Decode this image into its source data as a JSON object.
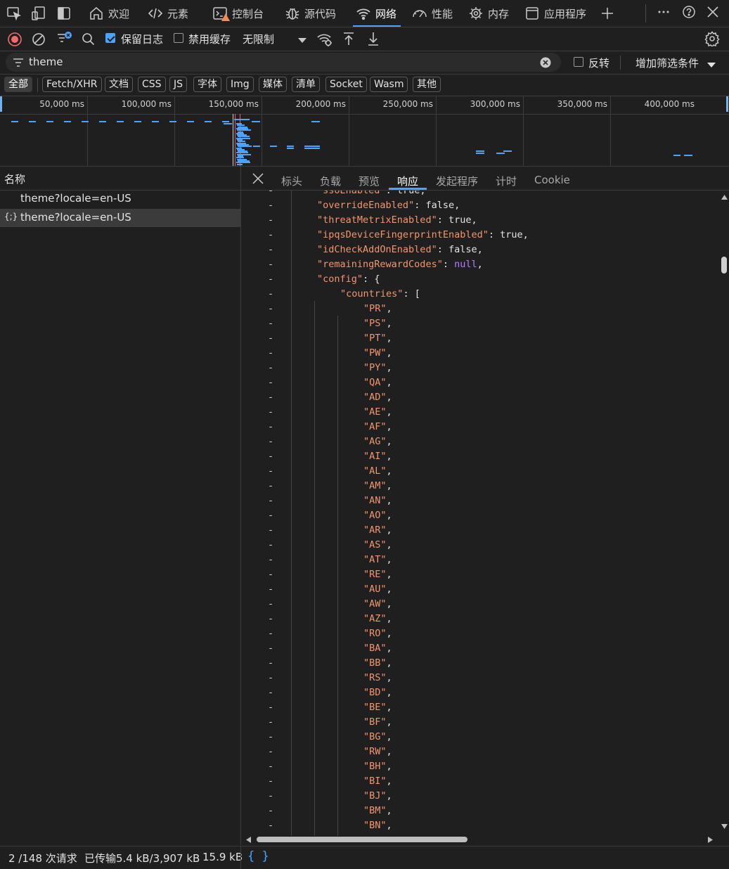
{
  "top_tabs": [
    {
      "label": "欢迎",
      "icon": "home-icon"
    },
    {
      "label": "元素",
      "icon": "code-icon"
    },
    {
      "label": "控制台",
      "icon": "console-icon"
    },
    {
      "label": "源代码",
      "icon": "bug-icon"
    },
    {
      "label": "网络",
      "icon": "wifi-icon"
    },
    {
      "label": "性能",
      "icon": "gauge-icon"
    },
    {
      "label": "内存",
      "icon": "memory-icon"
    },
    {
      "label": "应用程序",
      "icon": "app-window-icon"
    }
  ],
  "toolbar": {
    "preserve_log_label": "保留日志",
    "preserve_log_checked": true,
    "disable_cache_label": "禁用缓存",
    "disable_cache_checked": false,
    "throttle_value": "无限制"
  },
  "filter": {
    "search_value": "theme",
    "invert_label": "反转",
    "invert_checked": false,
    "more_filters_label": "增加筛选条件"
  },
  "type_filters": [
    "全部",
    "Fetch/XHR",
    "文档",
    "CSS",
    "JS",
    "字体",
    "Img",
    "媒体",
    "清单",
    "Socket",
    "Wasm",
    "其他"
  ],
  "overview": {
    "ticks": [
      "50,000 ms",
      "100,000 ms",
      "150,000 ms",
      "200,000 ms",
      "250,000 ms",
      "300,000 ms",
      "350,000 ms",
      "400,000 ms"
    ]
  },
  "request_list": {
    "header": "名称",
    "rows": [
      {
        "name": "theme?locale=en-US",
        "icon": "",
        "selected": false
      },
      {
        "name": "theme?locale=en-US",
        "icon": "{;}",
        "selected": true
      }
    ]
  },
  "detail_tabs": [
    "标头",
    "负载",
    "预览",
    "响应",
    "发起程序",
    "计时",
    "Cookie"
  ],
  "active_detail_tab": "响应",
  "response_lines": [
    {
      "indent": 1,
      "key": "ssoEnabled",
      "value": "true",
      "vtype": "lit",
      "suffix": ","
    },
    {
      "indent": 1,
      "key": "overrideEnabled",
      "value": "false",
      "vtype": "lit",
      "suffix": ","
    },
    {
      "indent": 1,
      "key": "threatMetrixEnabled",
      "value": "true",
      "vtype": "lit",
      "suffix": ","
    },
    {
      "indent": 1,
      "key": "ipqsDeviceFingerprintEnabled",
      "value": "true",
      "vtype": "lit",
      "suffix": ","
    },
    {
      "indent": 1,
      "key": "idCheckAddOnEnabled",
      "value": "false",
      "vtype": "lit",
      "suffix": ","
    },
    {
      "indent": 1,
      "key": "remainingRewardCodes",
      "value": "null",
      "vtype": "nul",
      "suffix": ","
    },
    {
      "indent": 1,
      "key": "config",
      "value": "{",
      "vtype": "lit",
      "suffix": ""
    },
    {
      "indent": 2,
      "key": "countries",
      "value": "[",
      "vtype": "lit",
      "suffix": ""
    }
  ],
  "country_codes": [
    "PR",
    "PS",
    "PT",
    "PW",
    "PY",
    "QA",
    "AD",
    "AE",
    "AF",
    "AG",
    "AI",
    "AL",
    "AM",
    "AN",
    "AO",
    "AR",
    "AS",
    "AT",
    "RE",
    "AU",
    "AW",
    "AZ",
    "RO",
    "BA",
    "BB",
    "RS",
    "BD",
    "BE",
    "BF",
    "BG",
    "RW",
    "BH",
    "BI",
    "BJ",
    "BM",
    "BN"
  ],
  "status_bar": {
    "requests": "2 /148 次请求",
    "transferred": "已传输5.4 kB/3,907 kB",
    "resources": "15.9 kB",
    "format_button": "{ }"
  }
}
